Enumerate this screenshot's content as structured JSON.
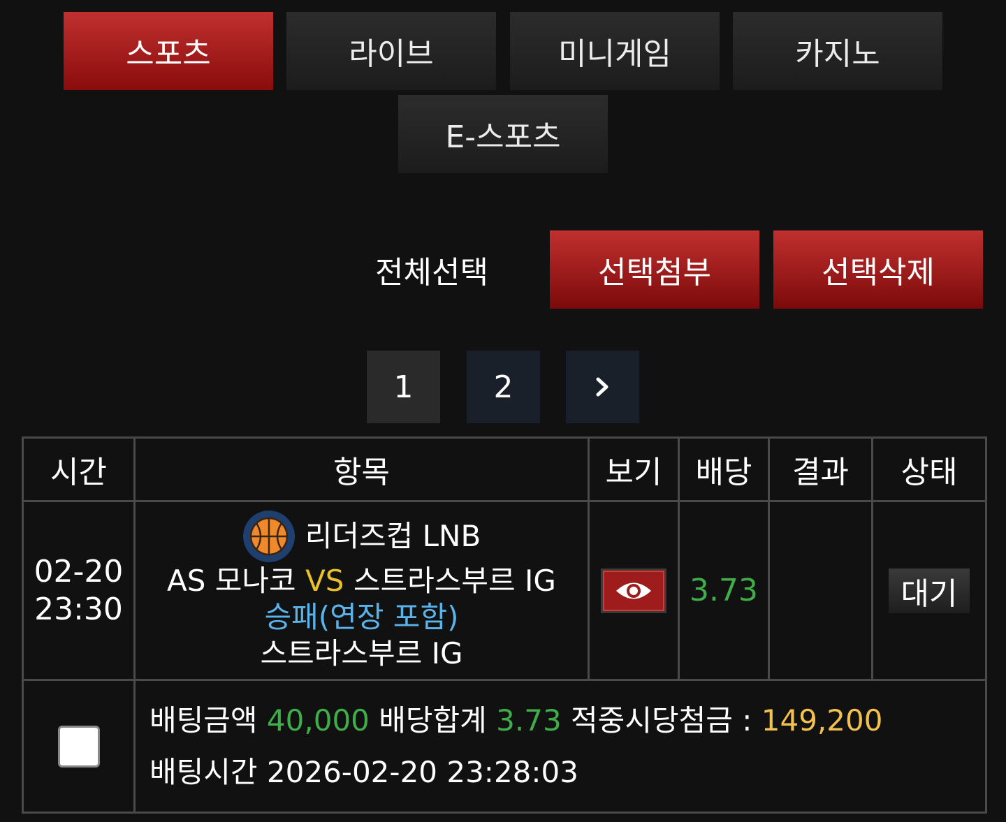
{
  "nav": {
    "tabs": [
      {
        "label": "스포츠",
        "active": true
      },
      {
        "label": "라이브",
        "active": false
      },
      {
        "label": "미니게임",
        "active": false
      },
      {
        "label": "카지노",
        "active": false
      },
      {
        "label": "E-스포츠",
        "active": false
      }
    ]
  },
  "actions": {
    "select_all": "전체선택",
    "attach_selected": "선택첨부",
    "delete_selected": "선택삭제"
  },
  "pagination": {
    "pages": [
      "1",
      "2"
    ],
    "next_icon": "chevron-right-icon",
    "current_page_color": "#2a2a2a",
    "other_page_color": "#1a2029"
  },
  "table": {
    "headers": [
      "시간",
      "항목",
      "보기",
      "배당",
      "결과",
      "상태"
    ],
    "row": {
      "date": "02-20",
      "time": "23:30",
      "sport_icon": "basketball-icon",
      "league": "리더즈컵 LNB",
      "home_team": "AS 모나코",
      "vs": "VS",
      "away_team": "스트라스부르 IG",
      "market": "승패(연장 포함)",
      "pick": "스트라스부르 IG",
      "view_icon": "eye-icon",
      "odds": "3.73",
      "result": "",
      "status": "대기"
    },
    "summary": {
      "bet_amount_label": "배팅금액",
      "bet_amount": "40,000",
      "odds_total_label": "배당합계",
      "odds_total": "3.73",
      "payout_label": "적중시당첨금 :",
      "payout": "149,200",
      "bet_time_label": "배팅시간",
      "bet_time": "2026-02-20 23:28:03",
      "checked": false
    }
  },
  "colors": {
    "accent_red": "#b52020",
    "odds_green": "#3fae49",
    "payout_gold": "#f2c14e",
    "market_blue": "#5ab4ec",
    "vs_yellow": "#e8c02a"
  }
}
